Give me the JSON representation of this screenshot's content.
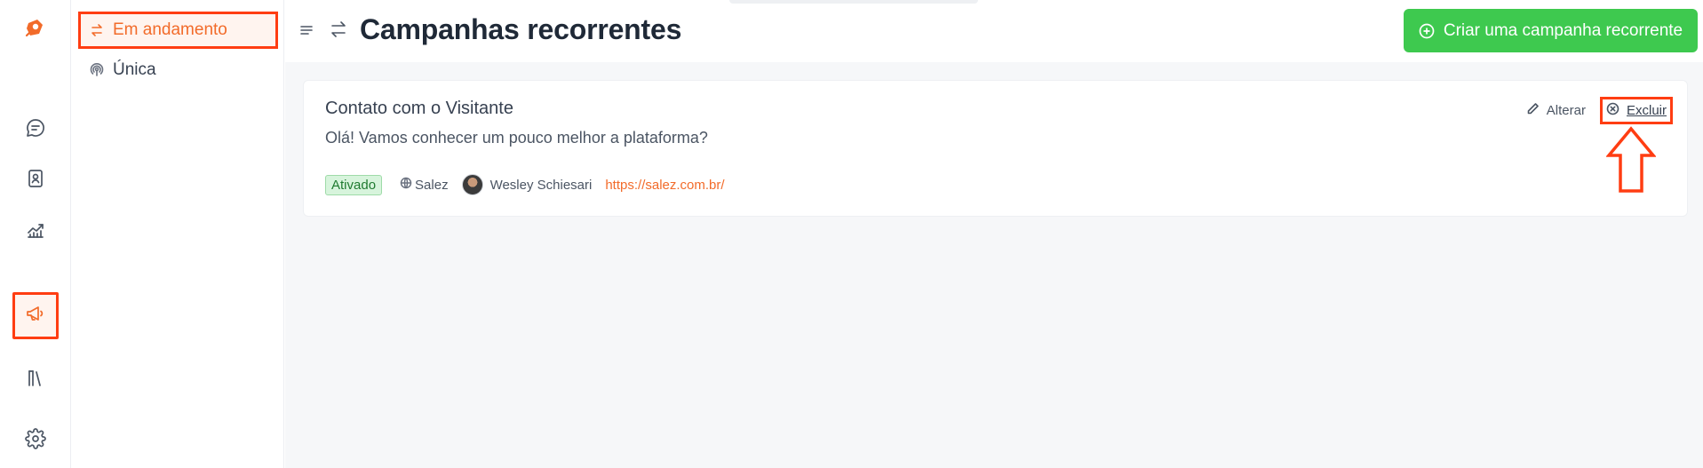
{
  "app": {
    "brand_color": "#f26b2a",
    "highlight_color": "#ff3d12"
  },
  "rail": {
    "items": [
      {
        "name": "chat",
        "icon": "chat-bubble-icon",
        "active": false
      },
      {
        "name": "contacts",
        "icon": "address-book-icon",
        "active": false
      },
      {
        "name": "reports",
        "icon": "chart-line-icon",
        "active": false
      },
      {
        "name": "campaigns",
        "icon": "megaphone-icon",
        "active": true
      },
      {
        "name": "library",
        "icon": "library-icon",
        "active": false
      },
      {
        "name": "settings",
        "icon": "gear-icon",
        "active": false
      }
    ]
  },
  "subnav": {
    "items": [
      {
        "label": "Em andamento",
        "icon": "arrows-swap-icon",
        "active": true
      },
      {
        "label": "Única",
        "icon": "broadcast-icon",
        "active": false
      }
    ]
  },
  "header": {
    "title": "Campanhas recorrentes",
    "title_icon": "arrows-swap-icon",
    "create_button": "Criar uma campanha recorrente",
    "create_button_color": "#3ec94f"
  },
  "campaign": {
    "title": "Contato com o Visitante",
    "message": "Olá! Vamos conhecer um pouco melhor a plataforma?",
    "status": "Ativado",
    "site": "Salez",
    "owner": "Wesley Schiesari",
    "url": "https://salez.com.br/",
    "edit_label": "Alterar",
    "delete_label": "Excluir"
  }
}
